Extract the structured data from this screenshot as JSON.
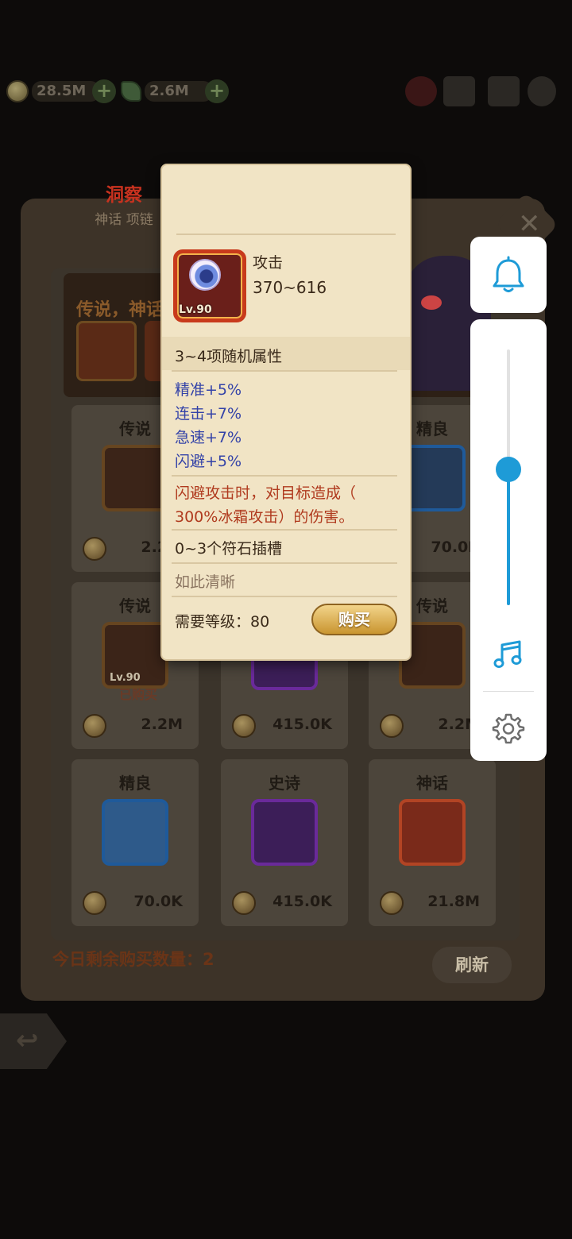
{
  "hud": {
    "gold": "28.5M",
    "gems": "2.6M"
  },
  "shop": {
    "banner_title": "传说，神话",
    "remaining_label": "今日剩余购买数量：2",
    "refresh_label": "刷新",
    "cards": [
      {
        "rarity": "传说",
        "price": "2.2M"
      },
      {
        "rarity": "",
        "price": ""
      },
      {
        "rarity": "精良",
        "price": "70.0K"
      },
      {
        "rarity": "传说",
        "price": "2.2M",
        "level": "Lv.90",
        "status": "已购买"
      },
      {
        "rarity": "",
        "price": "415.0K"
      },
      {
        "rarity": "传说",
        "price": "2.2M"
      },
      {
        "rarity": "精良",
        "price": "70.0K"
      },
      {
        "rarity": "史诗",
        "price": "415.0K"
      },
      {
        "rarity": "神话",
        "price": "21.8M"
      }
    ]
  },
  "tooltip": {
    "name": "洞察",
    "subtitle": "神话 项链",
    "level_badge": "Lv.90",
    "stat_label": "攻击",
    "stat_value": "370~616",
    "random_header": "3~4项随机属性",
    "attributes": [
      "精准+5%",
      "连击+7%",
      "急速+7%",
      "闪避+5%"
    ],
    "effect_line1": "闪避攻击时，对目标造成（",
    "effect_line2": "300%冰霜攻击）的伤害。",
    "sockets": "0~3个符石插槽",
    "flavor": "如此清晰",
    "required_level": "需要等级：80",
    "buy_label": "购买"
  },
  "system_panel": {
    "volume_level": 0.53,
    "accent_color": "#1e9bd7"
  }
}
